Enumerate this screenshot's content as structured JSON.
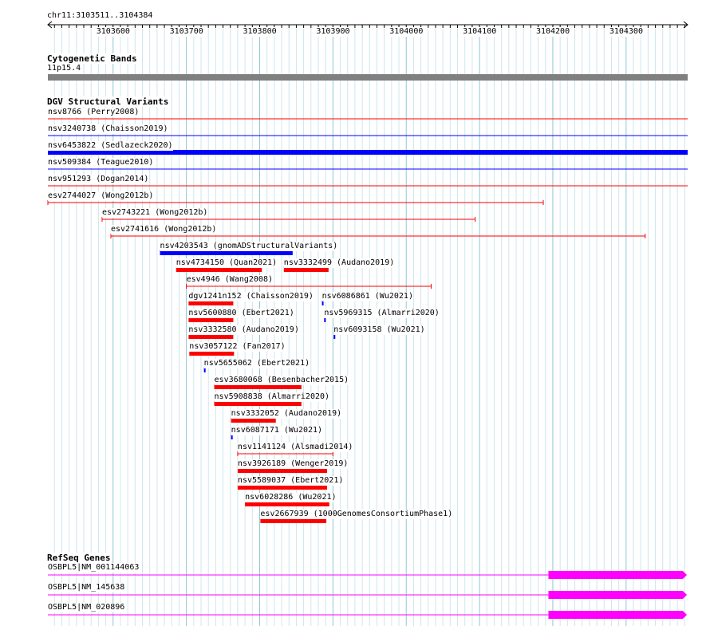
{
  "locus": "chr11:3103511..3104384",
  "ruler": {
    "start": 3103511,
    "end": 3104384,
    "ticks": [
      3103600,
      3103700,
      3103800,
      3103900,
      3104000,
      3104100,
      3104200,
      3104300
    ]
  },
  "cytogenetic": {
    "title": "Cytogenetic Bands",
    "band": "11p15.4",
    "color": "#808080"
  },
  "dgv": {
    "title": "DGV Structural Variants",
    "colors": {
      "loss": "#ff0000",
      "gain": "#0000ff"
    },
    "features": [
      {
        "label": "nsv8766 (Perry2008)",
        "start": 3103511,
        "end": 3104384,
        "type": "loss",
        "style": "line"
      },
      {
        "label": "nsv3240738 (Chaisson2019)",
        "start": 3103511,
        "end": 3104384,
        "type": "gain",
        "style": "line"
      },
      {
        "label": "nsv6453822 (Sedlazeck2020)",
        "start": 3103511,
        "end": 3104384,
        "type": "gain",
        "style": "thick"
      },
      {
        "label": "nsv509384 (Teague2010)",
        "start": 3103511,
        "end": 3104384,
        "type": "gain",
        "style": "line"
      },
      {
        "label": "nsv951293 (Dogan2014)",
        "start": 3103511,
        "end": 3104384,
        "type": "loss",
        "style": "line"
      },
      {
        "label": "esv2744027 (Wong2012b)",
        "start": 3103511,
        "end": 3104187,
        "type": "loss",
        "style": "bracket"
      },
      {
        "label": "esv2743221 (Wong2012b)",
        "start": 3103585,
        "end": 3104094,
        "type": "loss",
        "style": "bracket"
      },
      {
        "label": "esv2741616 (Wong2012b)",
        "start": 3103597,
        "end": 3104326,
        "type": "loss",
        "style": "bracket"
      },
      {
        "label": "nsv4203543 (gnomADStructuralVariants)",
        "start": 3103664,
        "end": 3103845,
        "type": "gain",
        "style": "bar"
      },
      {
        "label": "nsv4734150 (Quan2021)",
        "start": 3103686,
        "end": 3103803,
        "type": "loss",
        "style": "bar"
      },
      {
        "label": "nsv3332499 (Audano2019)",
        "start": 3103833,
        "end": 3103894,
        "type": "loss",
        "style": "bar"
      },
      {
        "label": "esv4946 (Wang2008)",
        "start": 3103700,
        "end": 3104034,
        "type": "loss",
        "style": "bracket"
      },
      {
        "label": "dgv1241n152 (Chaisson2019)",
        "start": 3103703,
        "end": 3103764,
        "type": "loss",
        "style": "bar"
      },
      {
        "label": "nsv6086861 (Wu2021)",
        "start": 3103885,
        "end": 3103887,
        "type": "gain",
        "style": "bar"
      },
      {
        "label": "nsv5600880 (Ebert2021)",
        "start": 3103703,
        "end": 3103764,
        "type": "loss",
        "style": "bar"
      },
      {
        "label": "nsv5969315 (Almarri2020)",
        "start": 3103888,
        "end": 3103890,
        "type": "gain",
        "style": "bar"
      },
      {
        "label": "nsv3332580 (Audano2019)",
        "start": 3103703,
        "end": 3103764,
        "type": "loss",
        "style": "bar"
      },
      {
        "label": "nsv6093158 (Wu2021)",
        "start": 3103901,
        "end": 3103903,
        "type": "gain",
        "style": "bar"
      },
      {
        "label": "nsv3057122 (Fan2017)",
        "start": 3103704,
        "end": 3103765,
        "type": "loss",
        "style": "bar"
      },
      {
        "label": "nsv5655062 (Ebert2021)",
        "start": 3103724,
        "end": 3103726,
        "type": "gain",
        "style": "bar"
      },
      {
        "label": "esv3680068 (Besenbacher2015)",
        "start": 3103738,
        "end": 3103857,
        "type": "loss",
        "style": "bar"
      },
      {
        "label": "nsv5908838 (Almarri2020)",
        "start": 3103738,
        "end": 3103857,
        "type": "loss",
        "style": "bar"
      },
      {
        "label": "nsv3332052 (Audano2019)",
        "start": 3103761,
        "end": 3103822,
        "type": "loss",
        "style": "bar"
      },
      {
        "label": "nsv6087171 (Wu2021)",
        "start": 3103761,
        "end": 3103763,
        "type": "gain",
        "style": "bar"
      },
      {
        "label": "nsv1141124 (Alsmadi2014)",
        "start": 3103770,
        "end": 3103900,
        "type": "loss",
        "style": "bracket"
      },
      {
        "label": "nsv3926189 (Wenger2019)",
        "start": 3103770,
        "end": 3103892,
        "type": "loss",
        "style": "bar"
      },
      {
        "label": "nsv5589037 (Ebert2021)",
        "start": 3103770,
        "end": 3103892,
        "type": "loss",
        "style": "bar"
      },
      {
        "label": "nsv6028286 (Wu2021)",
        "start": 3103780,
        "end": 3103895,
        "type": "loss",
        "style": "bar"
      },
      {
        "label": "esv2667939 (1000GenomesConsortiumPhase1)",
        "start": 3103801,
        "end": 3103891,
        "type": "loss",
        "style": "bar"
      }
    ]
  },
  "refseq": {
    "title": "RefSeq Genes",
    "color": "#ff00ff",
    "genes": [
      {
        "label": "OSBPL5|NM_001144063",
        "intron_start": 3103511,
        "intron_end": 3104194,
        "exon_start": 3104194,
        "exon_end": 3104384
      },
      {
        "label": "OSBPL5|NM_145638",
        "intron_start": 3103511,
        "intron_end": 3104194,
        "exon_start": 3104194,
        "exon_end": 3104384
      },
      {
        "label": "OSBPL5|NM_020896",
        "intron_start": 3103511,
        "intron_end": 3104194,
        "exon_start": 3104194,
        "exon_end": 3104384
      }
    ]
  }
}
